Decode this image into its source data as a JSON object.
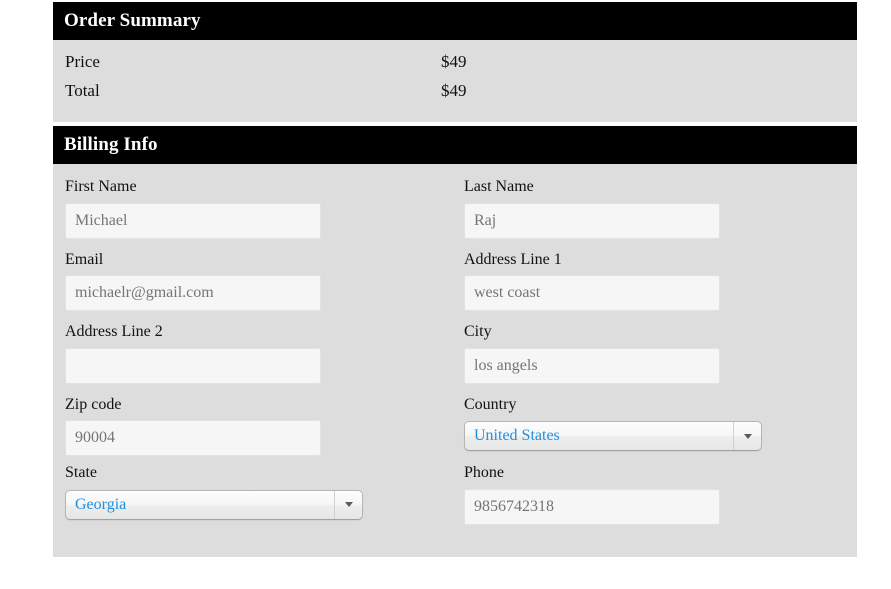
{
  "order_summary": {
    "title": "Order Summary",
    "rows": [
      {
        "label": "Price",
        "value": "$49"
      },
      {
        "label": "Total",
        "value": "$49"
      }
    ]
  },
  "billing_info": {
    "title": "Billing Info",
    "fields": {
      "first_name": {
        "label": "First Name",
        "value": "Michael"
      },
      "last_name": {
        "label": "Last Name",
        "value": "Raj"
      },
      "email": {
        "label": "Email",
        "value": "michaelr@gmail.com"
      },
      "address_line_1": {
        "label": "Address Line 1",
        "value": "west coast"
      },
      "address_line_2": {
        "label": "Address Line 2",
        "value": ""
      },
      "city": {
        "label": "City",
        "value": "los angels"
      },
      "zip_code": {
        "label": "Zip code",
        "value": "90004"
      },
      "country": {
        "label": "Country",
        "value": "United States"
      },
      "state": {
        "label": "State",
        "value": "Georgia"
      },
      "phone": {
        "label": "Phone",
        "value": "9856742318"
      }
    }
  },
  "colors": {
    "header_bg": "#000000",
    "header_text": "#ffffff",
    "panel_bg": "#dddddd",
    "page_bg": "#ffffff",
    "input_bg": "#f6f6f6",
    "input_text": "#757575",
    "select_text": "#1f90e0",
    "label_text": "#111111"
  },
  "icons": {
    "dropdown_arrow": "chevron-down-icon"
  }
}
